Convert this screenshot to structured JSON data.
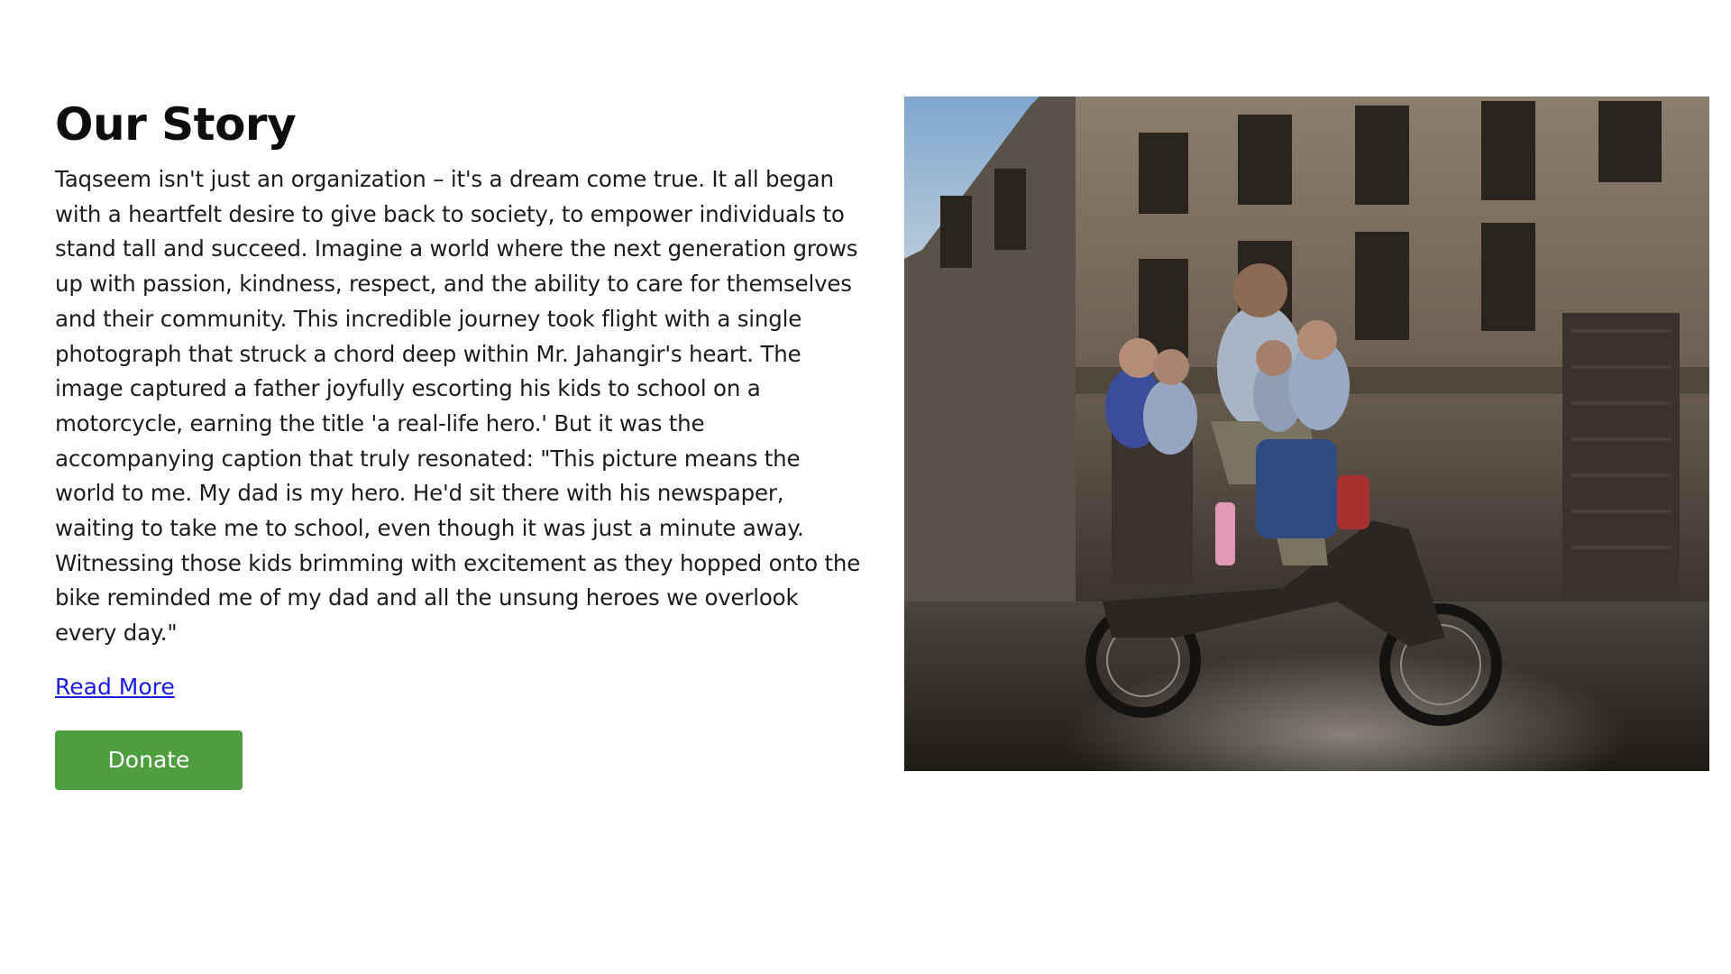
{
  "story": {
    "title": "Our Story",
    "body": "Taqseem isn't just an organization – it's a dream come true. It all began with a heartfelt desire to give back to society, to empower individuals to stand tall and succeed. Imagine a world where the next generation grows up with passion, kindness, respect, and the ability to care for themselves and their community. This incredible journey took flight with a single photograph that struck a chord deep within Mr. Jahangir's heart. The image captured a father joyfully escorting his kids to school on a motorcycle, earning the title 'a real-life hero.' But it was the accompanying caption that truly resonated: \"This picture means the world to me. My dad is my hero. He'd sit there with his newspaper, waiting to take me to school, even though it was just a minute away. Witnessing those kids brimming with excitement as they hopped onto the bike reminded me of my dad and all the unsung heroes we overlook every day.\"",
    "read_more": "Read More",
    "donate": "Donate"
  },
  "colors": {
    "accent": "#4e9e40",
    "link": "#1a1ae6"
  }
}
